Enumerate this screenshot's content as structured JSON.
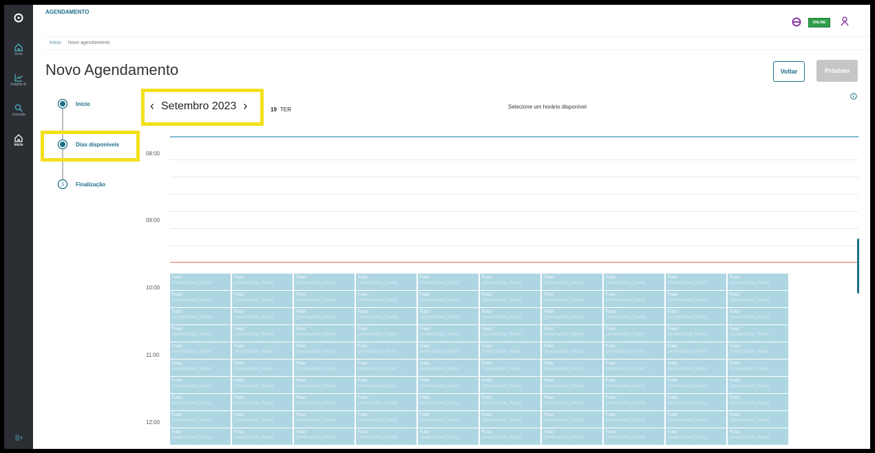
{
  "app": {
    "section_title": "AGENDAMENTO",
    "status_badge": "ONLINE"
  },
  "sidebar": {
    "items": [
      {
        "label": "Início",
        "icon": "home-icon"
      },
      {
        "label": "Insights AI",
        "icon": "chart-icon"
      },
      {
        "label": "Consulta",
        "icon": "search-icon"
      },
      {
        "label": "Início",
        "icon": "home-icon"
      }
    ]
  },
  "breadcrumb": {
    "home": "Início",
    "current": "Novo agendamento"
  },
  "page": {
    "title": "Novo Agendamento"
  },
  "actions": {
    "back_label": "Voltar",
    "next_label": "Próximo"
  },
  "steps": [
    {
      "label": "Início"
    },
    {
      "label": "Dias disponíveis"
    },
    {
      "number": "3",
      "label": "Finalização"
    }
  ],
  "calendar": {
    "month_label": "Setembro 2023",
    "day_number": "19",
    "day_name": "TER",
    "instruction": "Selecione um horário disponível",
    "hours": [
      "08:00",
      "09:00",
      "10:00",
      "11:00",
      "12:00"
    ],
    "slot_label": "Fuso:",
    "slot_sub": "(America/Sao_Paulo)",
    "slot_rows": 10,
    "slot_cols": 10
  },
  "colors": {
    "accent": "#1d6e87",
    "slot": "#aed6e2",
    "online": "#2e9e4a",
    "now_line": "#e26b4c",
    "highlight": "#f3e01d"
  }
}
